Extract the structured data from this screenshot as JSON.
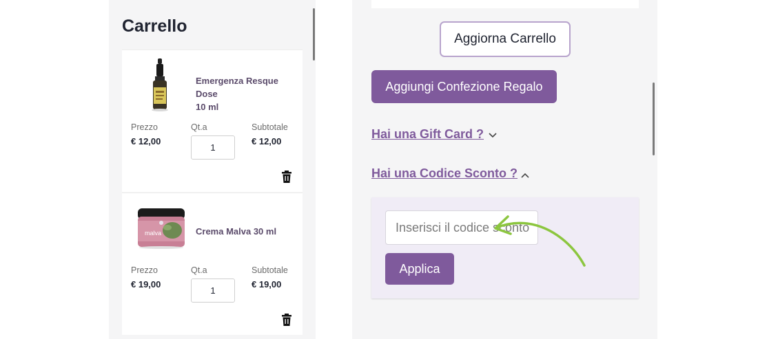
{
  "cart": {
    "title": "Carrello",
    "columns": {
      "price": "Prezzo",
      "qty": "Qt.a",
      "subtotal": "Subtotale"
    },
    "items": [
      {
        "name_line1": "Emergenza Resque Dose",
        "name_line2": "10 ml",
        "price": "€ 12,00",
        "qty": "1",
        "subtotal": "€ 12,00",
        "image_icon": "dropper-bottle-image"
      },
      {
        "name_line1": "Crema Malva 30 ml",
        "name_line2": "",
        "price": "€ 19,00",
        "qty": "1",
        "subtotal": "€ 19,00",
        "image_icon": "cream-jar-image",
        "jar_label": "malva"
      }
    ]
  },
  "actions": {
    "update_cart": "Aggiorna Carrello",
    "gift_wrap": "Aggiungi Confezione Regalo",
    "gift_card_link": "Hai una Gift Card ?",
    "discount_link": "Hai una Codice Sconto ?"
  },
  "coupon": {
    "placeholder": "Inserisci il codice sconto",
    "apply": "Applica"
  },
  "colors": {
    "accent": "#7f5a9c",
    "arrow": "#8cc63f",
    "panel_bg": "#f5f5f6"
  }
}
